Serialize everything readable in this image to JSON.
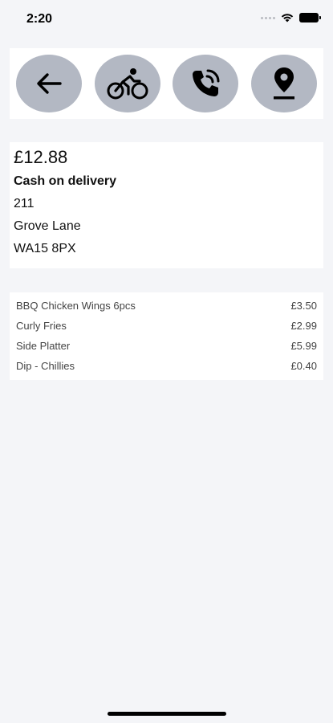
{
  "status_bar": {
    "time": "2:20"
  },
  "actions": [
    {
      "name": "back",
      "icon": "arrow-left-icon"
    },
    {
      "name": "delivery",
      "icon": "cyclist-icon"
    },
    {
      "name": "call",
      "icon": "phone-ringing-icon"
    },
    {
      "name": "location",
      "icon": "map-pin-icon"
    }
  ],
  "order": {
    "total": "£12.88",
    "payment": "Cash on delivery",
    "address_line1": "211",
    "address_line2": "Grove Lane",
    "postcode": "WA15 8PX"
  },
  "items": [
    {
      "name": "BBQ Chicken Wings 6pcs",
      "price": "£3.50"
    },
    {
      "name": "Curly Fries",
      "price": "£2.99"
    },
    {
      "name": "Side Platter",
      "price": "£5.99"
    },
    {
      "name": "Dip - Chillies",
      "price": "£0.40"
    }
  ],
  "colors": {
    "background": "#f4f5f8",
    "card": "#ffffff",
    "action_button": "#b3b8c3"
  }
}
